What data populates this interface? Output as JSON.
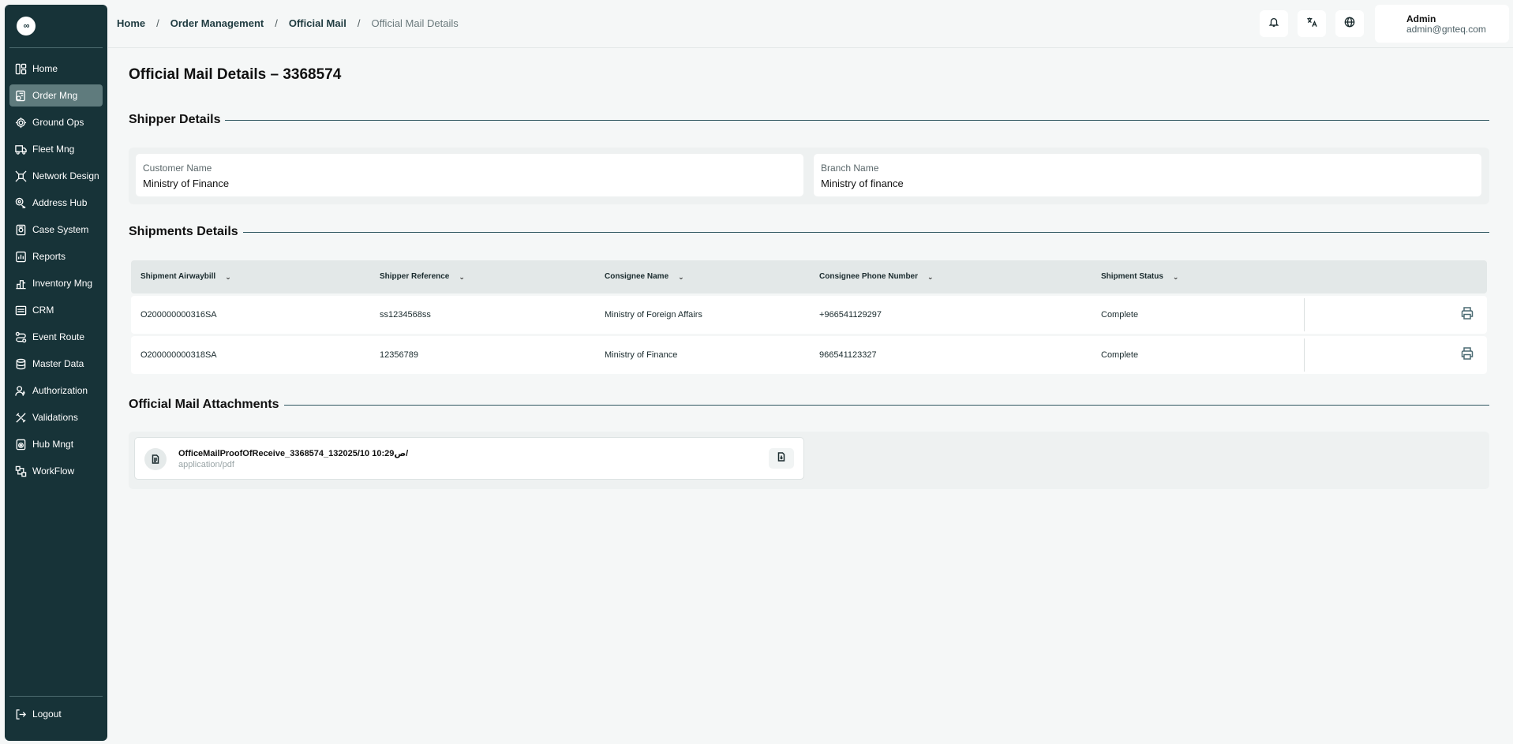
{
  "sidebar": {
    "logo_text": "∞",
    "items": [
      {
        "label": "Home",
        "icon": "grid-icon",
        "active": false
      },
      {
        "label": "Order Mng",
        "icon": "order-icon",
        "active": true
      },
      {
        "label": "Ground Ops",
        "icon": "radar-icon",
        "active": false
      },
      {
        "label": "Fleet Mng",
        "icon": "truck-icon",
        "active": false
      },
      {
        "label": "Network Design",
        "icon": "network-icon",
        "active": false
      },
      {
        "label": "Address Hub",
        "icon": "map-pin-icon",
        "active": false
      },
      {
        "label": "Case System",
        "icon": "case-icon",
        "active": false
      },
      {
        "label": "Reports",
        "icon": "reports-icon",
        "active": false
      },
      {
        "label": "Inventory Mng",
        "icon": "inventory-icon",
        "active": false
      },
      {
        "label": "CRM",
        "icon": "crm-icon",
        "active": false
      },
      {
        "label": "Event Route",
        "icon": "route-icon",
        "active": false
      },
      {
        "label": "Master Data",
        "icon": "database-icon",
        "active": false
      },
      {
        "label": "Authorization",
        "icon": "user-key-icon",
        "active": false
      },
      {
        "label": "Validations",
        "icon": "tools-icon",
        "active": false
      },
      {
        "label": "Hub Mngt",
        "icon": "hub-icon",
        "active": false
      },
      {
        "label": "WorkFlow",
        "icon": "workflow-icon",
        "active": false
      }
    ],
    "logout_label": "Logout"
  },
  "header": {
    "breadcrumb": [
      "Home",
      "Order Management",
      "Official Mail",
      "Official Mail Details"
    ],
    "separator": "/",
    "user": {
      "name": "Admin",
      "email": "admin@gnteq.com"
    }
  },
  "page": {
    "title": "Official Mail Details – 3368574",
    "shipper_section": "Shipper Details",
    "customer_label": "Customer Name",
    "customer_value": "Ministry of Finance",
    "branch_label": "Branch Name",
    "branch_value": "Ministry of finance",
    "shipments_section": "Shipments Details",
    "attachments_section": "Official Mail Attachments"
  },
  "table": {
    "columns": [
      "Shipment Airwaybill",
      "Shipper Reference",
      "Consignee Name",
      "Consignee Phone Number",
      "Shipment Status"
    ],
    "rows": [
      [
        "O200000000316SA",
        "ss1234568ss",
        "Ministry of Foreign Affairs",
        "+966541129297",
        "Complete"
      ],
      [
        "O200000000318SA",
        "12356789",
        "Ministry of Finance",
        "966541123327",
        "Complete"
      ]
    ]
  },
  "attachments": [
    {
      "name": "OfficeMailProofOfReceive_3368574_13ص10:29 2025/10/",
      "type": "application/pdf"
    }
  ],
  "colors": {
    "sidebar_bg": "#173338",
    "active_item": "#5f7b7d",
    "accent_line": "#2f5760"
  }
}
